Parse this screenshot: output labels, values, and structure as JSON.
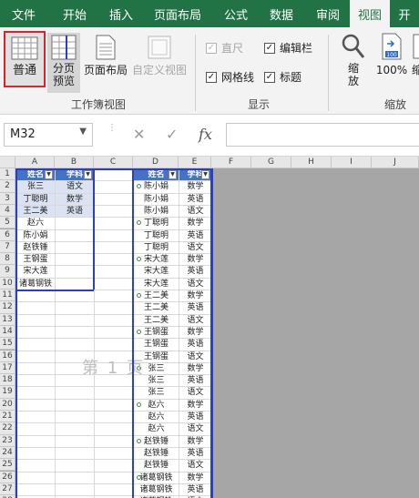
{
  "tabs": [
    {
      "label": "文件"
    },
    {
      "label": "开始"
    },
    {
      "label": "插入"
    },
    {
      "label": "页面布局"
    },
    {
      "label": "公式"
    },
    {
      "label": "数据"
    },
    {
      "label": "审阅"
    },
    {
      "label": "视图"
    },
    {
      "label": "开"
    }
  ],
  "ribbon": {
    "normal_label": "普通",
    "pagebreak_label": "分页预览",
    "pagelayout_label": "页面布局",
    "custom_label": "自定义视图",
    "group_workbook_views": "工作簿视图",
    "ruler_label": "直尺",
    "formulabar_label": "编辑栏",
    "gridlines_label": "网格线",
    "headings_label": "标题",
    "group_show": "显示",
    "zoom_label": "缩放",
    "zoom100_label": "100%",
    "zoomsel_label": "缩",
    "group_zoom": "缩放"
  },
  "formula_bar": {
    "name_box": "M32",
    "formula": ""
  },
  "sheet": {
    "columns": [
      "A",
      "B",
      "C",
      "D",
      "E",
      "F",
      "G",
      "H",
      "I",
      "J"
    ],
    "rows": [
      "1",
      "2",
      "3",
      "4",
      "5",
      "6",
      "7",
      "8",
      "9",
      "10",
      "11",
      "12",
      "13",
      "14",
      "15",
      "16",
      "17",
      "18",
      "19",
      "20",
      "21",
      "22",
      "23",
      "24",
      "25",
      "26",
      "27",
      "28"
    ],
    "colA": [
      "姓名",
      "张三",
      "丁聪明",
      "王二美",
      "赵六",
      "陈小娟",
      "赵铁锤",
      "王钢蛋",
      "宋大莲",
      "诸葛钢铁"
    ],
    "colB": [
      "学科",
      "语文",
      "数学",
      "英语"
    ],
    "colD": [
      "姓名",
      "陈小娟",
      "陈小娟",
      "陈小娟",
      "丁聪明",
      "丁聪明",
      "丁聪明",
      "宋大莲",
      "宋大莲",
      "宋大莲",
      "王二美",
      "王二美",
      "王二美",
      "王钢蛋",
      "王钢蛋",
      "王钢蛋",
      "张三",
      "张三",
      "张三",
      "赵六",
      "赵六",
      "赵六",
      "赵铁锤",
      "赵铁锤",
      "赵铁锤",
      "诸葛钢铁",
      "诸葛钢铁",
      "诸葛钢铁"
    ],
    "colE": [
      "学科",
      "数学",
      "英语",
      "语文",
      "数学",
      "英语",
      "语文",
      "数学",
      "英语",
      "语文",
      "数学",
      "英语",
      "语文",
      "数学",
      "英语",
      "语文",
      "数学",
      "英语",
      "语文",
      "数学",
      "英语",
      "语文",
      "数学",
      "英语",
      "语文",
      "数学",
      "英语",
      "语文"
    ],
    "watermark": "第 1 页"
  }
}
